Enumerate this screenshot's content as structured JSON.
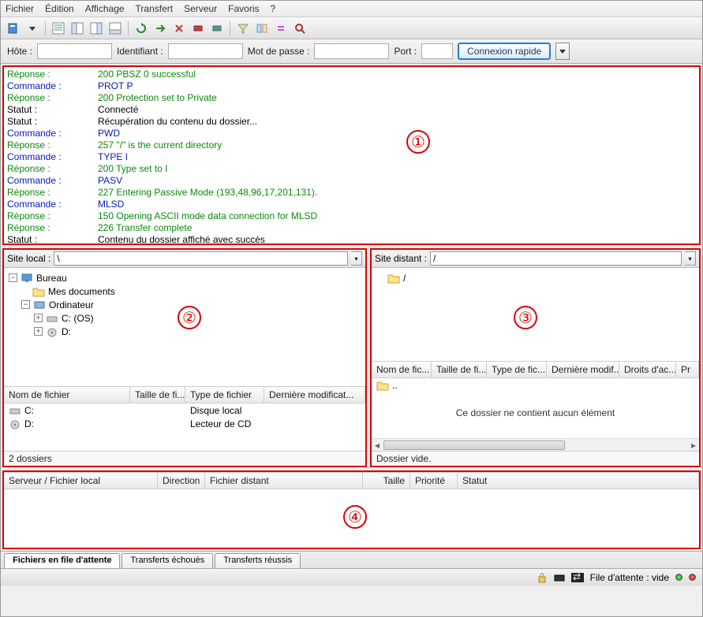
{
  "menu": [
    "Fichier",
    "Édition",
    "Affichage",
    "Transfert",
    "Serveur",
    "Favoris",
    "?"
  ],
  "quick": {
    "host_label": "Hôte :",
    "user_label": "Identifiant :",
    "pass_label": "Mot de passe :",
    "port_label": "Port :",
    "connect_label": "Connexion rapide"
  },
  "log": [
    {
      "t": "Réponse :",
      "c": "green",
      "m": "200 PBSZ 0 successful"
    },
    {
      "t": "Commande :",
      "c": "blue",
      "m": "PROT P"
    },
    {
      "t": "Réponse :",
      "c": "green",
      "m": "200 Protection set to Private"
    },
    {
      "t": "Statut :",
      "c": "black",
      "m": "Connecté"
    },
    {
      "t": "Statut :",
      "c": "black",
      "m": "Récupération du contenu du dossier..."
    },
    {
      "t": "Commande :",
      "c": "blue",
      "m": "PWD"
    },
    {
      "t": "Réponse :",
      "c": "green",
      "m": "257 \"/\" is the current directory"
    },
    {
      "t": "Commande :",
      "c": "blue",
      "m": "TYPE I"
    },
    {
      "t": "Réponse :",
      "c": "green",
      "m": "200 Type set to I"
    },
    {
      "t": "Commande :",
      "c": "blue",
      "m": "PASV"
    },
    {
      "t": "Réponse :",
      "c": "green",
      "m": "227 Entering Passive Mode (193,48,96,17,201,131)."
    },
    {
      "t": "Commande :",
      "c": "blue",
      "m": "MLSD"
    },
    {
      "t": "Réponse :",
      "c": "green",
      "m": "150 Opening ASCII mode data connection for MLSD"
    },
    {
      "t": "Réponse :",
      "c": "green",
      "m": "226 Transfer complete"
    },
    {
      "t": "Statut :",
      "c": "black",
      "m": "Contenu du dossier affiché avec succès"
    }
  ],
  "local": {
    "label": "Site local :",
    "path": "\\",
    "tree": {
      "root": "Bureau",
      "docs": "Mes documents",
      "computer": "Ordinateur",
      "c": "C: (OS)",
      "d": "D:"
    },
    "cols": [
      "Nom de fichier",
      "Taille de fi...",
      "Type de fichier",
      "Dernière modificat..."
    ],
    "rows": [
      {
        "name": "C:",
        "type": "Disque local"
      },
      {
        "name": "D:",
        "type": "Lecteur de CD"
      }
    ],
    "summary": "2 dossiers"
  },
  "remote": {
    "label": "Site distant :",
    "path": "/",
    "tree_root": "/",
    "cols": [
      "Nom de fic...",
      "Taille de fi...",
      "Type de fic...",
      "Dernière modif...",
      "Droits d'ac...",
      "Pr"
    ],
    "up": "..",
    "empty": "Ce dossier ne contient aucun élément",
    "summary": "Dossier vide."
  },
  "queue": {
    "cols": [
      "Serveur / Fichier local",
      "Direction",
      "Fichier distant",
      "Taille",
      "Priorité",
      "Statut"
    ]
  },
  "tabs": [
    "Fichiers en file d'attente",
    "Transferts échoués",
    "Transferts réussis"
  ],
  "status": {
    "queue": "File d'attente : vide"
  }
}
